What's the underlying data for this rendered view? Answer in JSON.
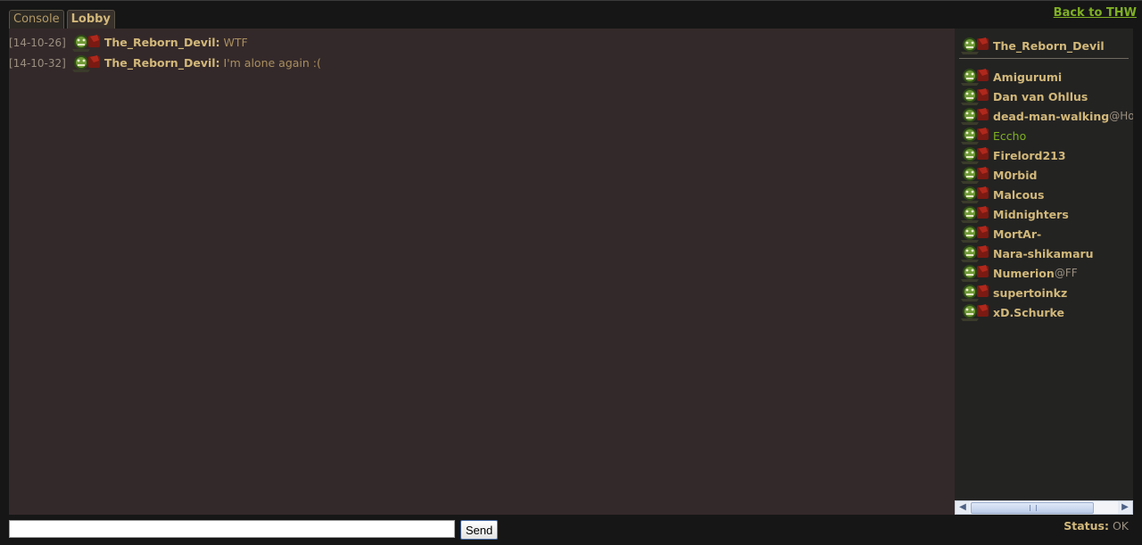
{
  "tabs": [
    {
      "label": "Console",
      "active": false
    },
    {
      "label": "Lobby",
      "active": true
    }
  ],
  "back_link": "Back to THW",
  "messages": [
    {
      "time": "[14-10-26]",
      "user": "The_Reborn_Devil:",
      "text": "WTF"
    },
    {
      "time": "[14-10-32]",
      "user": "The_Reborn_Devil:",
      "text": "I'm alone again :("
    }
  ],
  "current_user": "The_Reborn_Devil",
  "users": [
    {
      "name": "Amigurumi",
      "realm": ""
    },
    {
      "name": "Dan van Ohllus",
      "realm": ""
    },
    {
      "name": "dead-man-walking",
      "realm": "@Ho"
    },
    {
      "name": "Eccho",
      "realm": "",
      "highlight": true
    },
    {
      "name": "Firelord213",
      "realm": ""
    },
    {
      "name": "M0rbid",
      "realm": ""
    },
    {
      "name": "Malcous",
      "realm": ""
    },
    {
      "name": "Midnighters",
      "realm": ""
    },
    {
      "name": "MortAr-",
      "realm": ""
    },
    {
      "name": "Nara-shikamaru",
      "realm": ""
    },
    {
      "name": "Numerion",
      "realm": "@FF"
    },
    {
      "name": "supertoinkz",
      "realm": ""
    },
    {
      "name": "xD.Schurke",
      "realm": ""
    }
  ],
  "input": {
    "value": "",
    "placeholder": ""
  },
  "send_label": "Send",
  "status": {
    "label": "Status:",
    "value": "OK"
  },
  "colors": {
    "accent_green": "#7fb023",
    "name_gold": "#d2b87a",
    "chat_bg": "#34292a"
  },
  "icons": {
    "avatar": "orc-peon-portrait-icon"
  }
}
